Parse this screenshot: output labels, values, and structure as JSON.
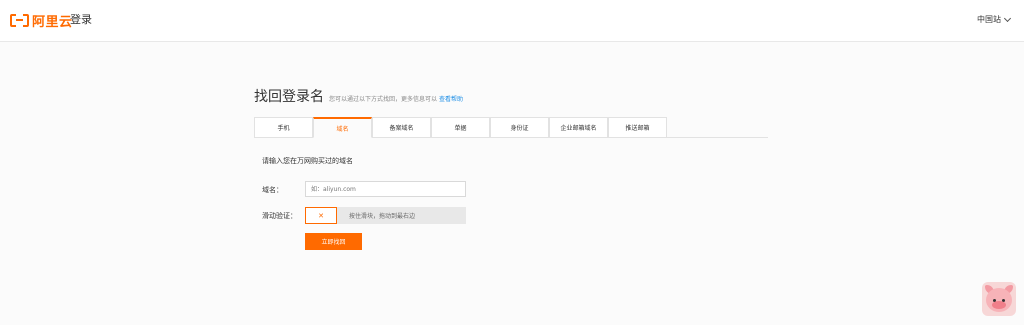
{
  "header": {
    "logo_text": "阿里云",
    "title": "登录",
    "site_switch": "中国站"
  },
  "page": {
    "title": "找回登录名",
    "subtitle": "您可以通过以下方式找回，更多信息可以",
    "help_link": "查看帮助"
  },
  "tabs": [
    {
      "label": "手机",
      "active": false
    },
    {
      "label": "域名",
      "active": true
    },
    {
      "label": "备案域名",
      "active": false
    },
    {
      "label": "单据",
      "active": false
    },
    {
      "label": "身份证",
      "active": false
    },
    {
      "label": "企业邮箱域名",
      "active": false
    },
    {
      "label": "推送邮箱",
      "active": false
    }
  ],
  "form": {
    "instruction": "请输入您在万网购买过的域名",
    "domain_label": "域名：",
    "domain_placeholder": "如：aliyun.com",
    "slider_label": "滑动验证：",
    "slider_handle": "✕",
    "slider_hint": "按住滑块，拖动到最右边",
    "submit_label": "立即找回"
  },
  "colors": {
    "accent": "#ff6a00",
    "link": "#1d8ee6"
  }
}
